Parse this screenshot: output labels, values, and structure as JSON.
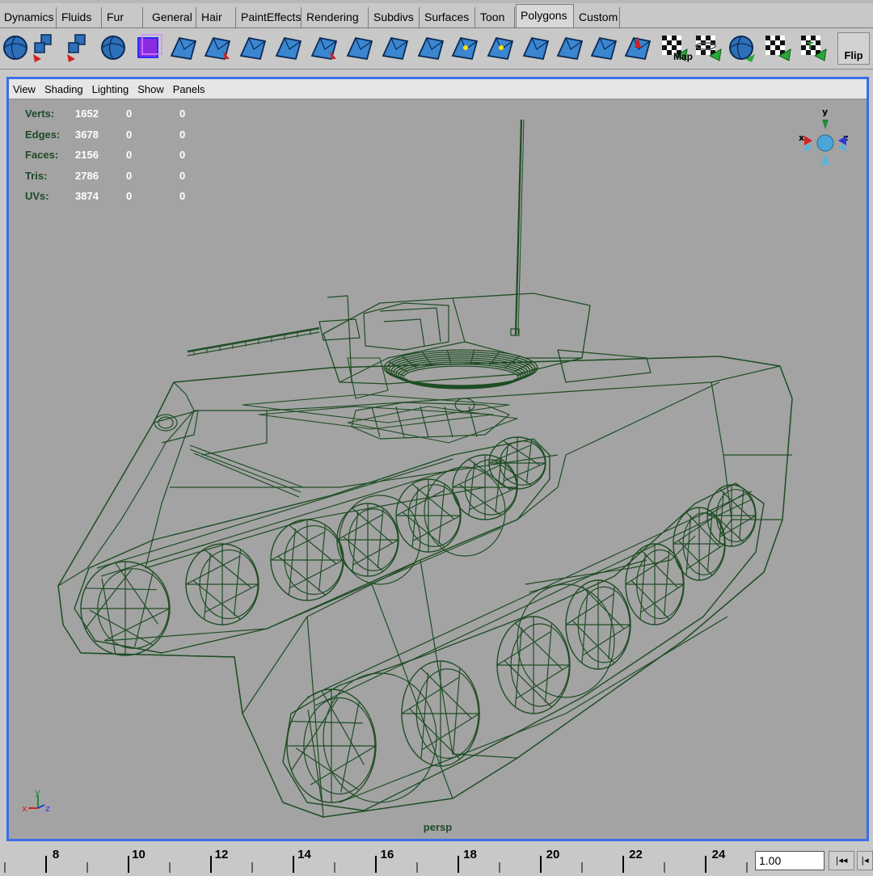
{
  "shelf_tabs": {
    "items": [
      "Dynamics",
      "Fluids",
      "Fur",
      "General",
      "Hair",
      "PaintEffects",
      "Rendering",
      "Subdivs",
      "Surfaces",
      "Toon",
      "Polygons",
      "Custom"
    ],
    "active": "Polygons"
  },
  "tool_shelf": {
    "tools": [
      "sphere-poly-icon",
      "combine-icon",
      "separate-icon",
      "smooth-sphere-icon",
      "cube-icon",
      "extrude-face-icon",
      "split-poly-icon",
      "bevel-icon",
      "wedge-face-icon",
      "poke-icon",
      "chamfer-icon",
      "duplicate-face-icon",
      "extract-icon",
      "merge-vertex-icon",
      "merge-edge-icon",
      "collapse-icon",
      "subdivide-icon",
      "quadrangulate-icon",
      "create-poly-icon",
      "planar-map-icon",
      "cylindrical-map-icon",
      "spherical-map-icon",
      "auto-map-icon",
      "uv-layout-icon",
      "uv-editor-icon"
    ],
    "flip_label": "Flip",
    "map_label": "Map"
  },
  "panel_menu": {
    "items": [
      "View",
      "Shading",
      "Lighting",
      "Show",
      "Panels"
    ]
  },
  "heads_up_display": {
    "rows": [
      {
        "label": "Verts:",
        "v1": "1652",
        "v2": "0",
        "v3": "0"
      },
      {
        "label": "Edges:",
        "v1": "3678",
        "v2": "0",
        "v3": "0"
      },
      {
        "label": "Faces:",
        "v1": "2156",
        "v2": "0",
        "v3": "0"
      },
      {
        "label": "Tris:",
        "v1": "2786",
        "v2": "0",
        "v3": "0"
      },
      {
        "label": "UVs:",
        "v1": "3874",
        "v2": "0",
        "v3": "0"
      }
    ]
  },
  "viewport": {
    "camera": "persp",
    "axis_labels": {
      "x": "x",
      "y": "y",
      "z": "z"
    },
    "wire_color": "#1e4d23",
    "background": "#a3a3a3"
  },
  "time_slider": {
    "ticks": [
      "8",
      "10",
      "12",
      "14",
      "16",
      "18",
      "20",
      "22",
      "24"
    ],
    "current_time": "1.00",
    "rewind_label": "|◂◂",
    "step_label": "|◂"
  },
  "colors": {
    "highlight_border": "#3a6ee8",
    "shelf_bg": "#c8c8c8",
    "hud_label": "#1f4a2a"
  }
}
